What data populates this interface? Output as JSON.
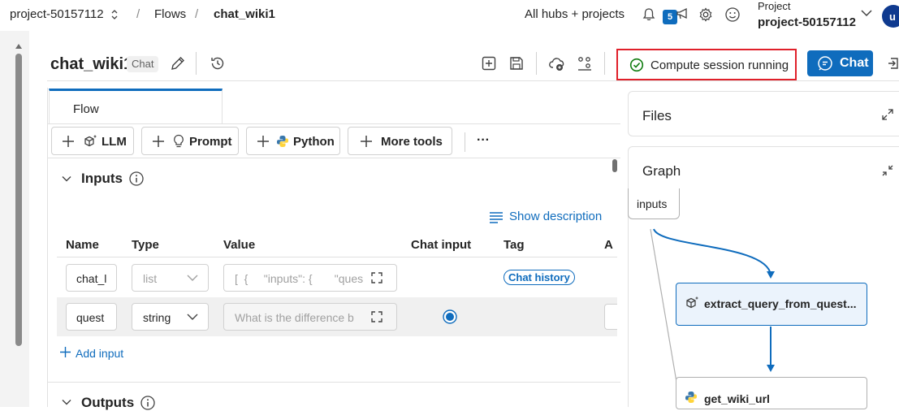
{
  "topbar": {
    "project_crumb": "project-50157112",
    "sep": "/",
    "flows_crumb": "Flows",
    "current_crumb": "chat_wiki1",
    "hubs_label": "All hubs + projects",
    "notif_count": "5",
    "project_caption": "Project",
    "project_name": "project-50157112",
    "avatar_initial": "u"
  },
  "flow_header": {
    "title": "chat_wiki1",
    "badge": "Chat",
    "compute_status": "Compute session running",
    "chat_label": "Chat"
  },
  "tabs": {
    "flow": "Flow"
  },
  "toolbar": {
    "llm": "LLM",
    "prompt": "Prompt",
    "python": "Python",
    "more_tools": "More tools",
    "more": "···"
  },
  "inputs": {
    "title": "Inputs",
    "show_description": "Show description",
    "columns": [
      "Name",
      "Type",
      "Value",
      "Chat input",
      "Tag",
      "A"
    ],
    "rows": [
      {
        "name": "chat_l",
        "type": "list",
        "value": "[  {     \"inputs\": {       \"ques",
        "tag": "Chat history"
      },
      {
        "name": "quest",
        "type": "string",
        "value": "What is the difference b",
        "chat_input": true
      }
    ],
    "add_input": "Add input"
  },
  "outputs": {
    "title": "Outputs"
  },
  "files": {
    "title": "Files"
  },
  "graph": {
    "title": "Graph",
    "nodes": {
      "inputs": "inputs",
      "extract": "extract_query_from_quest...",
      "get_wiki": "get_wiki_url"
    }
  },
  "colors": {
    "accent": "#0f6cbd",
    "highlight_border": "#e0202a",
    "success": "#107c10",
    "node_selected_bg": "#ebf3fc"
  }
}
